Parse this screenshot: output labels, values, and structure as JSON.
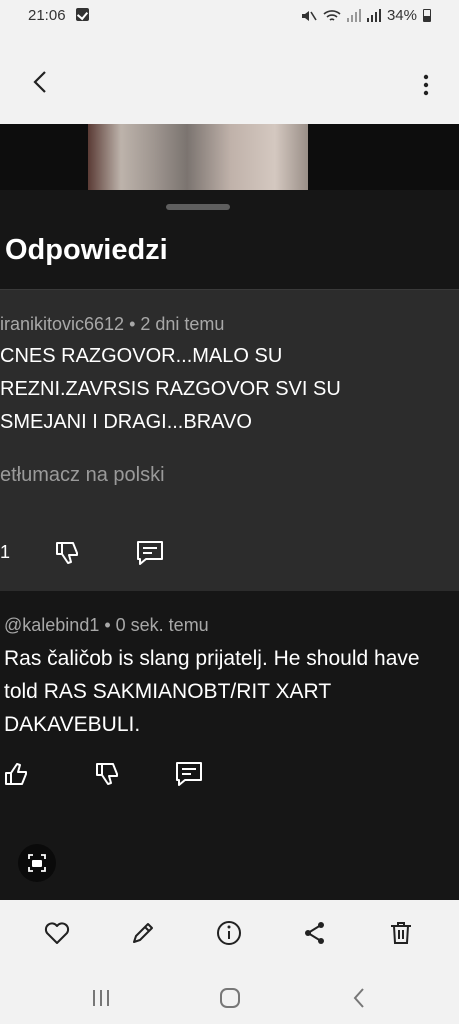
{
  "status_bar": {
    "time": "21:06",
    "battery": "34%"
  },
  "sheet": {
    "title": "Odpowiedzi"
  },
  "comment_main": {
    "author": "iranikitovic6612",
    "age": "2 dni temu",
    "lines": [
      "CNES RAZGOVOR...MALO SU",
      "REZNI.ZAVRSIS RAZGOVOR SVI SU",
      "SMEJANI I DRAGI...BRAVO"
    ],
    "translate": "etłumacz na polski",
    "like_count": "1"
  },
  "comment_reply": {
    "author": "@kalebind1",
    "age": "0 sek. temu",
    "lines": [
      "Ras čaličob  is slang prijatelj. He should have",
      "told RAS SAKMIANOBT/RIT XART",
      "DAKAVEBULI."
    ]
  },
  "colors": {
    "sheet_bg": "#161616",
    "highlight_bg": "#2c2c2c",
    "system_bg": "#f2f2f2"
  },
  "icons": [
    "back-arrow-icon",
    "more-vertical-icon",
    "thumbs-up-icon",
    "thumbs-down-icon",
    "reply-icon",
    "screenshot-icon",
    "heart-icon",
    "pencil-icon",
    "info-icon",
    "share-icon",
    "trash-icon",
    "recents-icon",
    "home-icon",
    "nav-back-icon"
  ]
}
